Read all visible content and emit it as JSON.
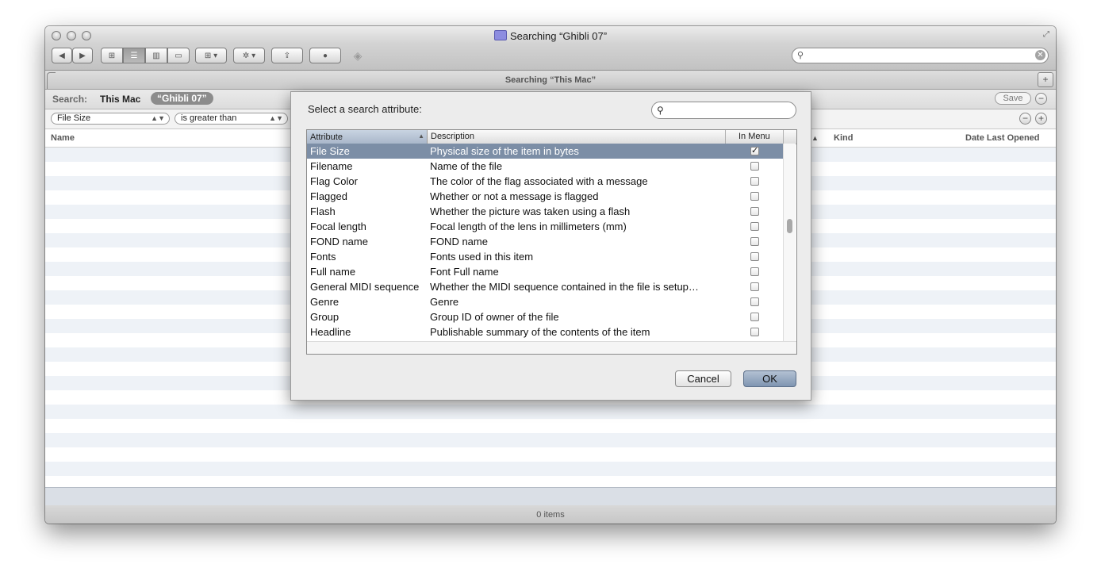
{
  "window": {
    "title": "Searching “Ghibli 07”",
    "path_title": "Searching “This Mac”"
  },
  "toolbar": {
    "back_label": "◀",
    "forward_label": "▶",
    "view_icon": "⊞",
    "list_icon": "☰",
    "column_icon": "▥",
    "coverflow_icon": "▭",
    "arrange_label": "⊞ ▾",
    "action_label": "✲ ▾",
    "share_label": "⇪",
    "label_label": "●",
    "dropbox_label": "◈",
    "search_placeholder": ""
  },
  "scope": {
    "label": "Search:",
    "this_mac": "This Mac",
    "folder": "“Ghibli 07”",
    "save": "Save",
    "minus": "−"
  },
  "criteria": {
    "attribute": "File Size",
    "operator": "is greater than",
    "minus": "−",
    "plus": "+"
  },
  "columns": {
    "name": "Name",
    "kind": "Kind",
    "date_last_opened": "Date Last Opened",
    "sort": "▲"
  },
  "status": {
    "items": "0 items"
  },
  "sheet": {
    "prompt": "Select a search attribute:",
    "search_placeholder": "",
    "headers": {
      "attribute": "Attribute",
      "description": "Description",
      "in_menu": "In Menu",
      "sort": "▲"
    },
    "rows": [
      {
        "attribute": "File Size",
        "description": "Physical size of the item in bytes",
        "in_menu": "✓"
      },
      {
        "attribute": "Filename",
        "description": "Name of the file",
        "in_menu": ""
      },
      {
        "attribute": "Flag Color",
        "description": "The color of the flag associated with a message",
        "in_menu": ""
      },
      {
        "attribute": "Flagged",
        "description": "Whether or not a message is flagged",
        "in_menu": ""
      },
      {
        "attribute": "Flash",
        "description": "Whether the picture was taken using a flash",
        "in_menu": ""
      },
      {
        "attribute": "Focal length",
        "description": "Focal length of the lens in millimeters (mm)",
        "in_menu": ""
      },
      {
        "attribute": "FOND name",
        "description": "FOND name",
        "in_menu": ""
      },
      {
        "attribute": "Fonts",
        "description": "Fonts used in this item",
        "in_menu": ""
      },
      {
        "attribute": "Full name",
        "description": "Font Full name",
        "in_menu": ""
      },
      {
        "attribute": "General MIDI sequence",
        "description": "Whether the MIDI sequence contained in the file is setup…",
        "in_menu": ""
      },
      {
        "attribute": "Genre",
        "description": "Genre",
        "in_menu": ""
      },
      {
        "attribute": "Group",
        "description": "Group ID of owner of the file",
        "in_menu": ""
      },
      {
        "attribute": "Headline",
        "description": "Publishable summary of the contents of the item",
        "in_menu": ""
      }
    ],
    "cancel": "Cancel",
    "ok": "OK"
  }
}
